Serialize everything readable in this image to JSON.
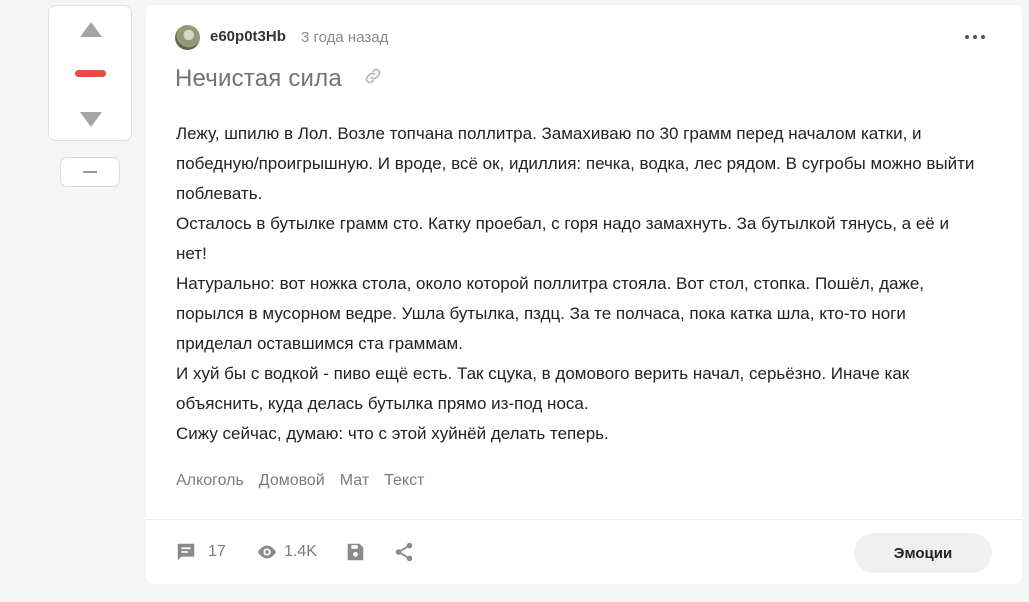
{
  "post": {
    "author": "e60p0t3Hb",
    "time_ago": "3 года назад",
    "title": "Нечистая сила",
    "paragraphs": [
      "Лежу, шпилю в Лол. Возле топчана поллитра. Замахиваю по 30 грамм перед началом катки, и победную/проигрышную. И вроде, всё ок, идиллия: печка, водка, лес рядом. В сугробы можно выйти поблевать.",
      "Осталось в бутылке грамм сто. Катку проебал, с горя надо замахнуть. За бутылкой тянусь, а её и нет!",
      "Натурально: вот ножка стола, около которой поллитра стояла. Вот стол, стопка. Пошёл, даже, порылся в мусорном ведре. Ушла бутылка, пздц. За те полчаса, пока катка шла, кто-то ноги приделал оставшимся ста граммам.",
      "И хуй бы с водкой - пиво ещё есть. Так сцука, в домового верить начал, серьёзно. Иначе как объяснить, куда делась бутылка прямо из-под носа.",
      "Сижу сейчас, думаю: что с этой хуйнёй делать теперь."
    ],
    "tags": [
      "Алкоголь",
      "Домовой",
      "Мат",
      "Текст"
    ]
  },
  "footer": {
    "comments_count": "17",
    "views_count": "1.4K",
    "emotions_label": "Эмоции"
  },
  "colors": {
    "vote_mid": "#e04e45",
    "icon_gray": "#8a8a8a"
  },
  "icons": [
    "arrow-up-icon",
    "arrow-down-icon",
    "more-icon",
    "link-icon",
    "comment-icon",
    "eye-icon",
    "save-icon",
    "share-icon"
  ]
}
